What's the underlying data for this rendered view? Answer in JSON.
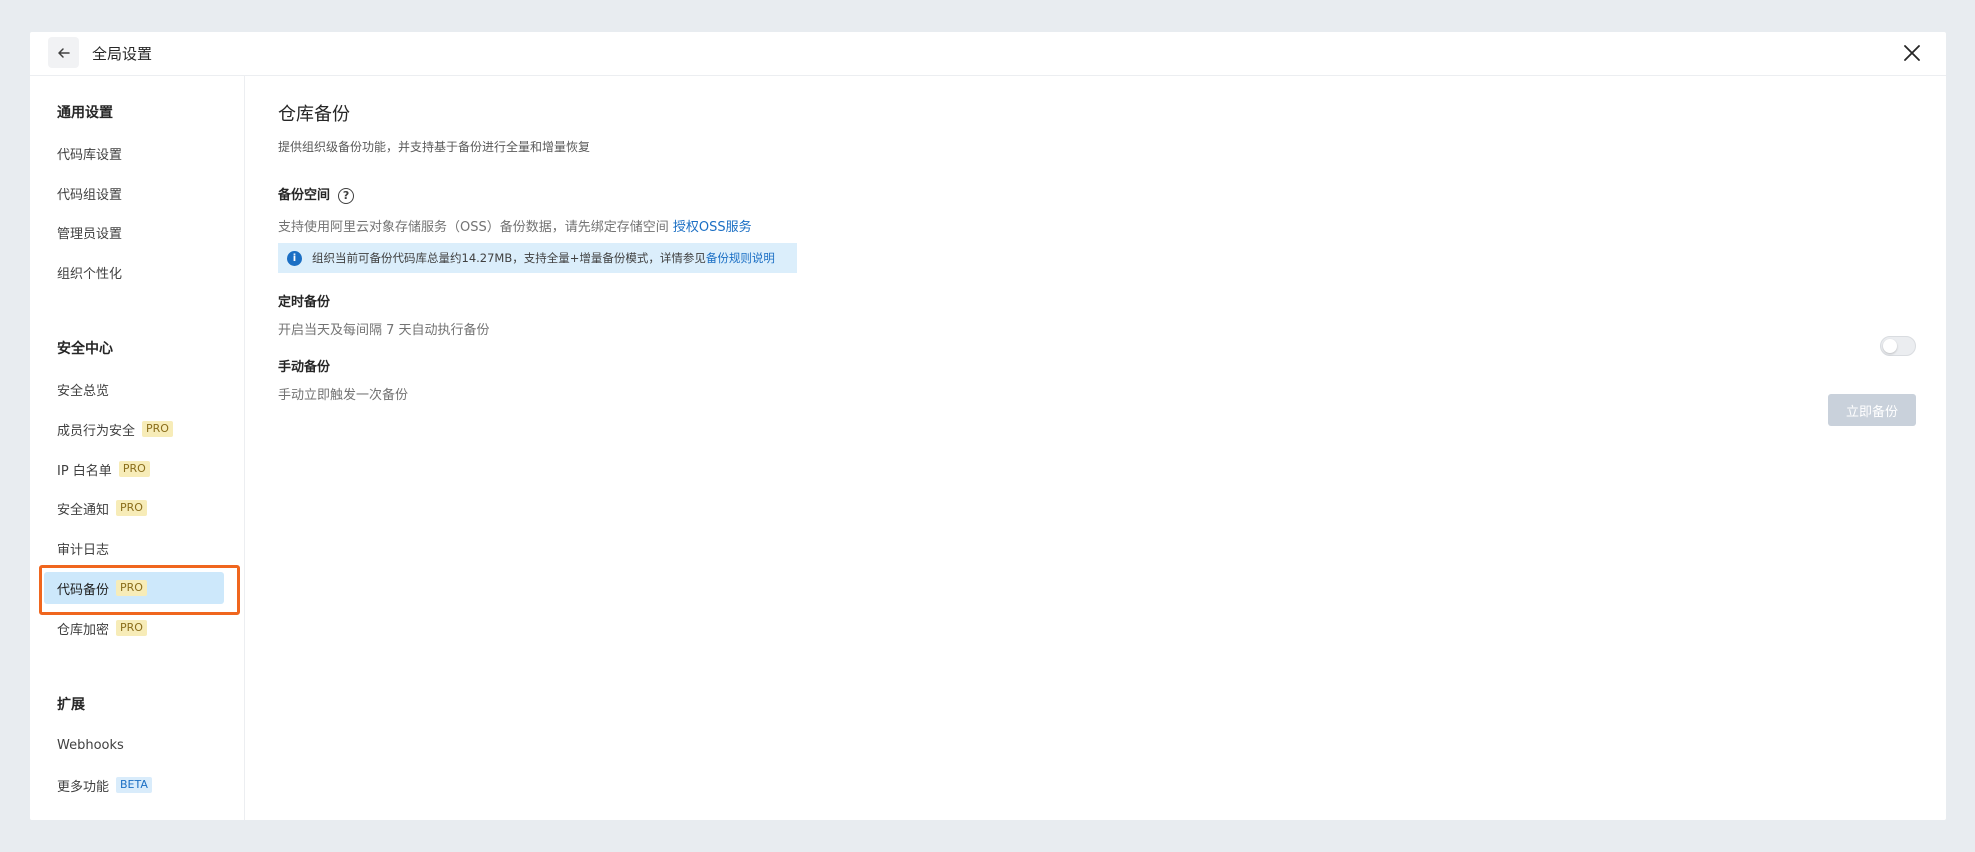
{
  "header": {
    "title": "全局设置"
  },
  "sidebar": {
    "sections": [
      {
        "title": "通用设置",
        "items": [
          {
            "label": "代码库设置"
          },
          {
            "label": "代码组设置"
          },
          {
            "label": "管理员设置"
          },
          {
            "label": "组织个性化"
          }
        ]
      },
      {
        "title": "安全中心",
        "items": [
          {
            "label": "安全总览"
          },
          {
            "label": "成员行为安全",
            "badge": "PRO"
          },
          {
            "label": "IP 白名单",
            "badge": "PRO"
          },
          {
            "label": "安全通知",
            "badge": "PRO"
          },
          {
            "label": "审计日志"
          },
          {
            "label": "代码备份",
            "badge": "PRO",
            "active": true
          },
          {
            "label": "仓库加密",
            "badge": "PRO"
          }
        ]
      },
      {
        "title": "扩展",
        "items": [
          {
            "label": "Webhooks"
          },
          {
            "label": "更多功能",
            "badge": "BETA"
          }
        ]
      }
    ]
  },
  "main": {
    "title": "仓库备份",
    "description": "提供组织级备份功能，并支持基于备份进行全量和增量恢复",
    "backup_space": {
      "title": "备份空间",
      "help_icon": "?",
      "description": "支持使用阿里云对象存储服务（OSS）备份数据，请先绑定存储空间",
      "link": "授权OSS服务",
      "info_text": "组织当前可备份代码库总量约14.27MB，支持全量+增量备份模式，详情参见",
      "info_link": "备份规则说明"
    },
    "scheduled": {
      "title": "定时备份",
      "description": "开启当天及每间隔 7 天自动执行备份",
      "enabled": false
    },
    "manual": {
      "title": "手动备份",
      "description": "手动立即触发一次备份",
      "button_label": "立即备份"
    }
  },
  "colors": {
    "accent": "#1b6fc4",
    "active_nav": "#cde8fb",
    "highlight": "#f0661e",
    "pro_badge": "#f7ecb8"
  }
}
